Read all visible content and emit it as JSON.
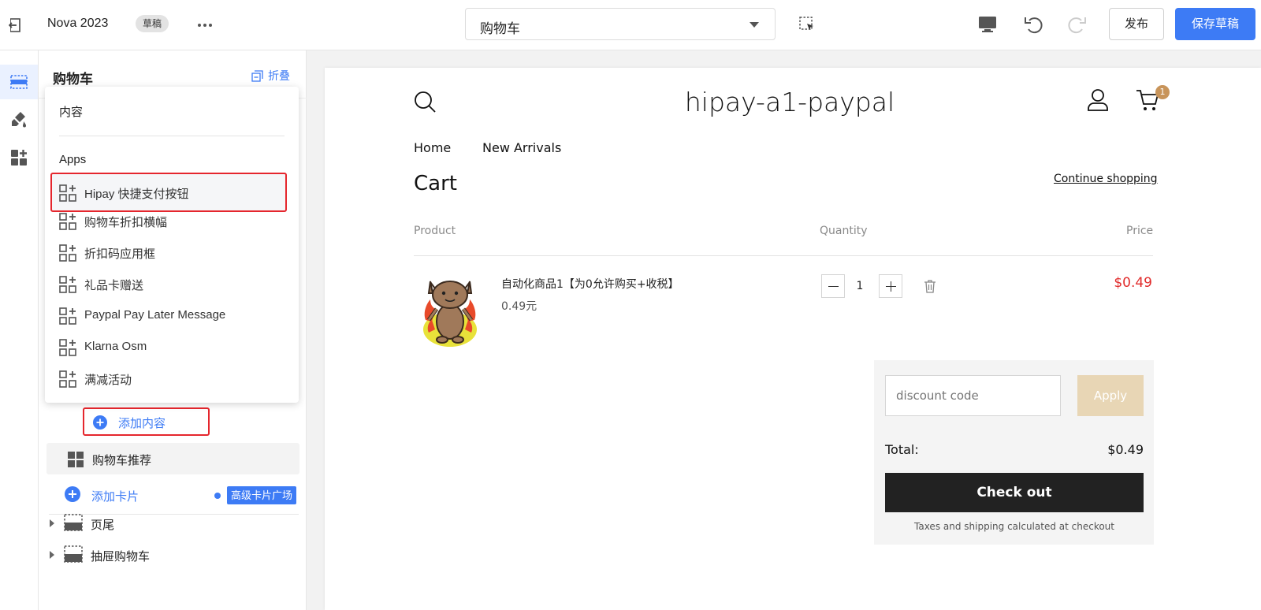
{
  "topbar": {
    "theme_name": "Nova 2023",
    "draft_badge": "草稿",
    "page_select": "购物车",
    "publish_label": "发布",
    "save_draft_label": "保存草稿"
  },
  "sidebar": {
    "title": "购物车",
    "collapse_label": "折叠",
    "add_content_label": "添加内容",
    "recommend_label": "购物车推荐",
    "add_card_label": "添加卡片",
    "advanced_badge": "高级卡片广场",
    "footer_label": "页尾",
    "drawer_cart_label": "抽屉购物车"
  },
  "popup": {
    "content_section": "内容",
    "apps_section": "Apps",
    "apps": [
      {
        "label": "Hipay 快捷支付按钮",
        "selected": true
      },
      {
        "label": "购物车折扣横幅"
      },
      {
        "label": "折扣码应用框"
      },
      {
        "label": "礼品卡赠送"
      },
      {
        "label": "Paypal Pay Later Message"
      },
      {
        "label": "Klarna Osm"
      },
      {
        "label": "满减活动"
      }
    ]
  },
  "store": {
    "title": "hipay-a1-paypal",
    "cart_count": "1",
    "nav": [
      "Home",
      "New Arrivals"
    ],
    "cart_heading": "Cart",
    "continue_shopping": "Continue shopping",
    "columns": {
      "product": "Product",
      "quantity": "Quantity",
      "price": "Price"
    },
    "item": {
      "name": "自动化商品1【为0允许购买+收税】",
      "unit_price": "0.49元",
      "quantity": "1",
      "line_price": "$0.49"
    },
    "discount_placeholder": "discount code",
    "apply_label": "Apply",
    "total_label": "Total:",
    "total_value": "$0.49",
    "checkout_label": "Check out",
    "tax_note": "Taxes and shipping calculated at checkout"
  },
  "colors": {
    "accent": "#3d7bf5",
    "highlight_border": "#e5262d",
    "price_red": "#e12b2b",
    "apply_disabled": "#e8d6b5"
  }
}
